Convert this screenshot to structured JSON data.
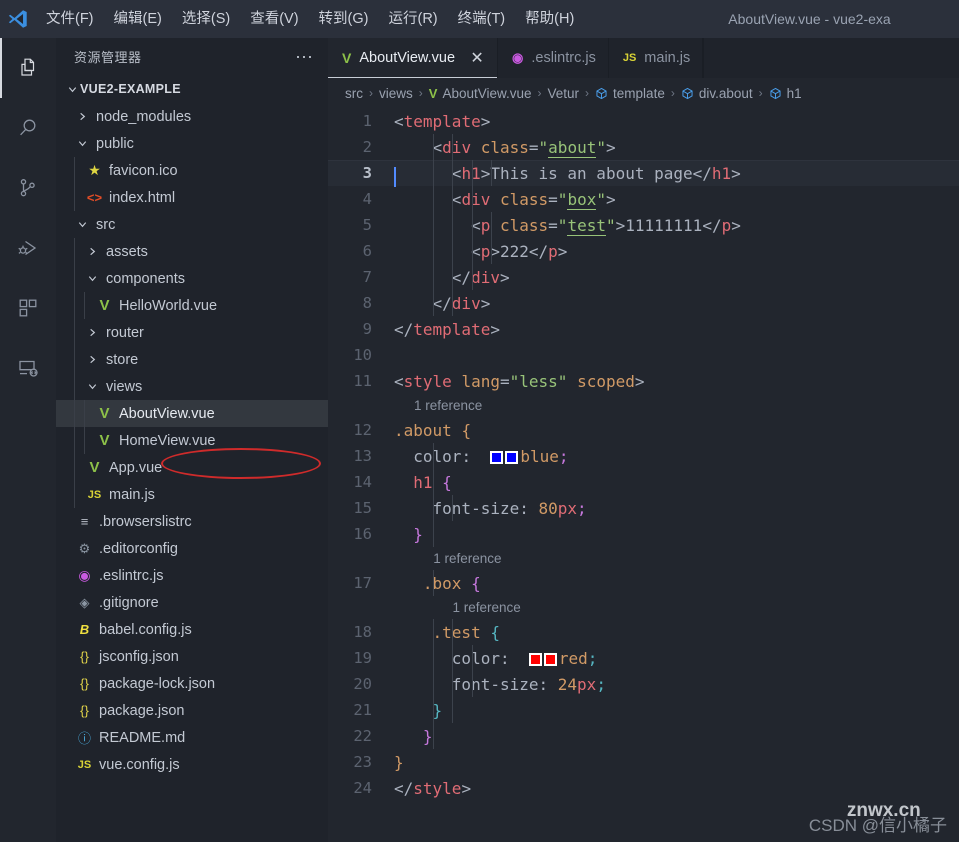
{
  "titlebar": {
    "window_title": "AboutView.vue - vue2-exa",
    "logo_icon": "vscode-logo-icon",
    "menus": [
      {
        "label": "文件(F)",
        "mnemonic": "F"
      },
      {
        "label": "编辑(E)",
        "mnemonic": "E"
      },
      {
        "label": "选择(S)",
        "mnemonic": "S"
      },
      {
        "label": "查看(V)",
        "mnemonic": "V"
      },
      {
        "label": "转到(G)",
        "mnemonic": "G"
      },
      {
        "label": "运行(R)",
        "mnemonic": "R"
      },
      {
        "label": "终端(T)",
        "mnemonic": "T"
      },
      {
        "label": "帮助(H)",
        "mnemonic": "H"
      }
    ]
  },
  "activitybar": {
    "items": [
      {
        "icon": "explorer-files-icon",
        "active": true
      },
      {
        "icon": "search-icon",
        "active": false
      },
      {
        "icon": "source-control-branch-icon",
        "active": false
      },
      {
        "icon": "run-and-debug-icon",
        "active": false
      },
      {
        "icon": "extensions-icon",
        "active": false
      },
      {
        "icon": "remote-explorer-icon",
        "active": false
      }
    ]
  },
  "sidebar": {
    "title": "资源管理器",
    "more_actions_icon": "ellipsis-icon",
    "root_folder": "VUE2-EXAMPLE",
    "root_expanded": true,
    "tree": [
      {
        "label": "node_modules",
        "type": "folder",
        "expanded": false,
        "depth": 1,
        "icon": "chevron-right-icon"
      },
      {
        "label": "public",
        "type": "folder",
        "expanded": true,
        "depth": 1,
        "icon": "chevron-down-icon"
      },
      {
        "label": "favicon.ico",
        "type": "file",
        "depth": 2,
        "icon": "star-icon"
      },
      {
        "label": "index.html",
        "type": "file",
        "depth": 2,
        "icon": "html-icon"
      },
      {
        "label": "src",
        "type": "folder",
        "expanded": true,
        "depth": 1,
        "icon": "chevron-down-icon"
      },
      {
        "label": "assets",
        "type": "folder",
        "expanded": false,
        "depth": 2,
        "icon": "chevron-right-icon"
      },
      {
        "label": "components",
        "type": "folder",
        "expanded": true,
        "depth": 2,
        "icon": "chevron-down-icon"
      },
      {
        "label": "HelloWorld.vue",
        "type": "file",
        "depth": 3,
        "icon": "vue-icon"
      },
      {
        "label": "router",
        "type": "folder",
        "expanded": false,
        "depth": 2,
        "icon": "chevron-right-icon"
      },
      {
        "label": "store",
        "type": "folder",
        "expanded": false,
        "depth": 2,
        "icon": "chevron-right-icon"
      },
      {
        "label": "views",
        "type": "folder",
        "expanded": true,
        "depth": 2,
        "icon": "chevron-down-icon"
      },
      {
        "label": "AboutView.vue",
        "type": "file",
        "depth": 3,
        "icon": "vue-icon",
        "selected": true,
        "annotated": true
      },
      {
        "label": "HomeView.vue",
        "type": "file",
        "depth": 3,
        "icon": "vue-icon"
      },
      {
        "label": "App.vue",
        "type": "file",
        "depth": 2,
        "icon": "vue-icon"
      },
      {
        "label": "main.js",
        "type": "file",
        "depth": 2,
        "icon": "js-icon"
      },
      {
        "label": ".browserslistrc",
        "type": "file",
        "depth": 1,
        "icon": "lines-icon"
      },
      {
        "label": ".editorconfig",
        "type": "file",
        "depth": 1,
        "icon": "gear-icon"
      },
      {
        "label": ".eslintrc.js",
        "type": "file",
        "depth": 1,
        "icon": "eslint-icon"
      },
      {
        "label": ".gitignore",
        "type": "file",
        "depth": 1,
        "icon": "git-icon"
      },
      {
        "label": "babel.config.js",
        "type": "file",
        "depth": 1,
        "icon": "babel-icon"
      },
      {
        "label": "jsconfig.json",
        "type": "file",
        "depth": 1,
        "icon": "json-braces-icon"
      },
      {
        "label": "package-lock.json",
        "type": "file",
        "depth": 1,
        "icon": "json-braces-icon"
      },
      {
        "label": "package.json",
        "type": "file",
        "depth": 1,
        "icon": "json-braces-icon"
      },
      {
        "label": "README.md",
        "type": "file",
        "depth": 1,
        "icon": "info-circle-icon"
      },
      {
        "label": "vue.config.js",
        "type": "file",
        "depth": 1,
        "icon": "js-icon"
      }
    ]
  },
  "editor": {
    "tabs": [
      {
        "label": "AboutView.vue",
        "icon": "vue-icon",
        "active": true,
        "close_icon": "close-icon",
        "close_label": "✕"
      },
      {
        "label": ".eslintrc.js",
        "icon": "eslint-icon",
        "active": false
      },
      {
        "label": "main.js",
        "icon": "js-icon",
        "active": false
      }
    ],
    "breadcrumb": [
      {
        "label": "src",
        "icon": null
      },
      {
        "label": "views",
        "icon": null
      },
      {
        "label": "AboutView.vue",
        "icon": "vue-icon"
      },
      {
        "label": "Vetur",
        "icon": null
      },
      {
        "label": "template",
        "icon": "symbol-cube-icon"
      },
      {
        "label": "div.about",
        "icon": "symbol-cube-icon"
      },
      {
        "label": "h1",
        "icon": "symbol-cube-icon"
      }
    ],
    "breadcrumb_separator": "›",
    "active_line": 3,
    "codelens_label": "1 reference",
    "colors": {
      "background": "#22262e",
      "sidebar_background": "#1f232b",
      "titlebar_background": "#2b303b",
      "accent_tag": "#e06c75",
      "accent_string": "#98c379",
      "accent_attr": "#d19a66",
      "cursor": "#528bff",
      "annotation": "#cf2b2b",
      "swatch_blue": "#0000ff",
      "swatch_red": "#ff0000"
    },
    "lines": [
      {
        "n": 1,
        "text": "<template>"
      },
      {
        "n": 2,
        "text": "    <div class=\"about\">"
      },
      {
        "n": 3,
        "text": "      <h1>This is an about page</h1>"
      },
      {
        "n": 4,
        "text": "      <div class=\"box\">"
      },
      {
        "n": 5,
        "text": "        <p class=\"test\">11111111</p>"
      },
      {
        "n": 6,
        "text": "        <p>222</p>"
      },
      {
        "n": 7,
        "text": "      </div>"
      },
      {
        "n": 8,
        "text": "    </div>"
      },
      {
        "n": 9,
        "text": "</template>"
      },
      {
        "n": 10,
        "text": ""
      },
      {
        "n": 11,
        "text": "<style lang=\"less\" scoped>"
      },
      {
        "n": 12,
        "text": ".about {"
      },
      {
        "n": 13,
        "text": "  color: blue;"
      },
      {
        "n": 14,
        "text": "  h1 {"
      },
      {
        "n": 15,
        "text": "    font-size: 80px;"
      },
      {
        "n": 16,
        "text": "  }"
      },
      {
        "n": 17,
        "text": "   .box {"
      },
      {
        "n": 18,
        "text": "    .test {"
      },
      {
        "n": 19,
        "text": "      color: red;"
      },
      {
        "n": 20,
        "text": "      font-size: 24px;"
      },
      {
        "n": 21,
        "text": "    }"
      },
      {
        "n": 22,
        "text": "   }"
      },
      {
        "n": 23,
        "text": "}"
      },
      {
        "n": 24,
        "text": "</style>"
      }
    ]
  },
  "watermark": {
    "text": "CSDN @信小橘子",
    "overlay": "znwx.cn"
  }
}
